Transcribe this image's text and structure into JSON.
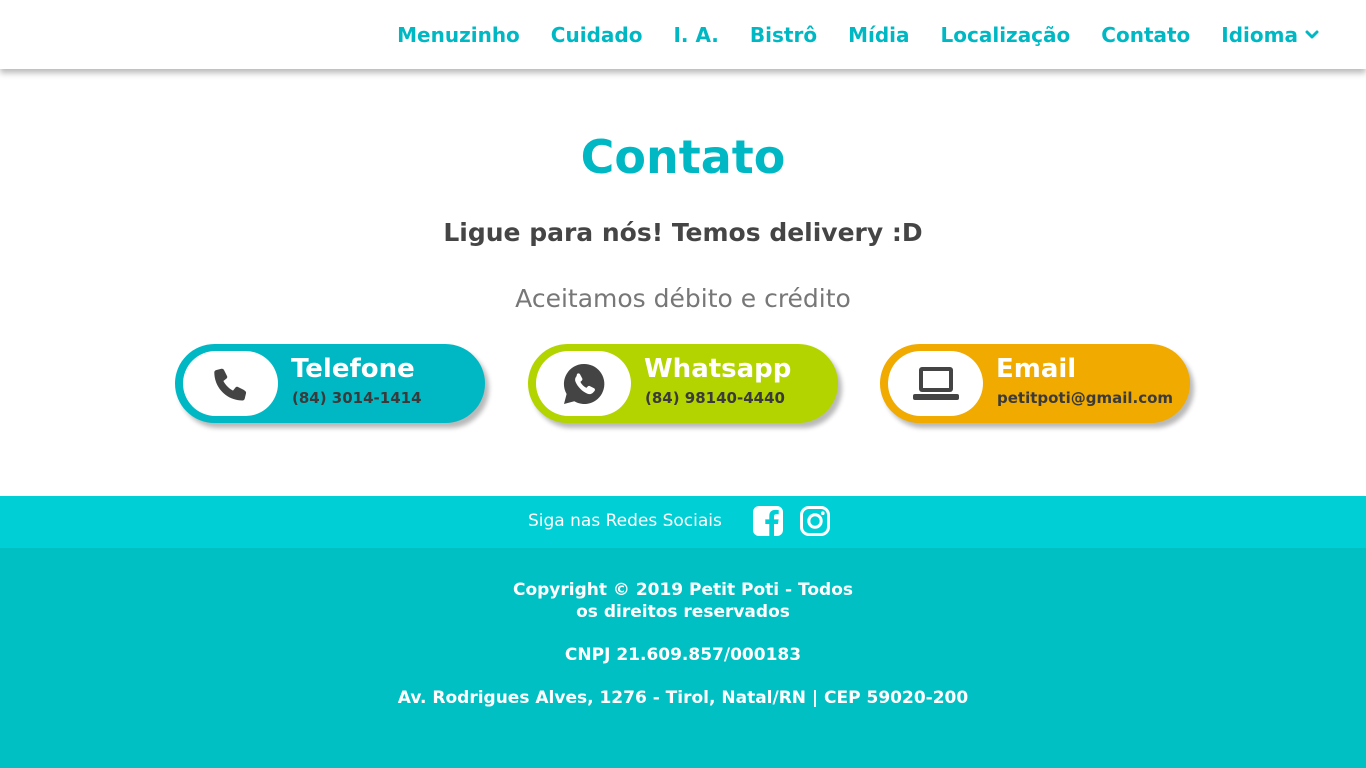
{
  "nav": {
    "items": [
      "Menuzinho",
      "Cuidado",
      "I. A.",
      "Bistrô",
      "Mídia",
      "Localização",
      "Contato"
    ],
    "language_label": "Idioma"
  },
  "main": {
    "title": "Contato",
    "subtitle": "Ligue para nós! Temos delivery :D",
    "payment_note": "Aceitamos débito e crédito"
  },
  "contacts": [
    {
      "title": "Telefone",
      "value": "(84) 3014-1414",
      "icon": "phone-icon",
      "color": "#00b8c4"
    },
    {
      "title": "Whatsapp",
      "value": "(84) 98140-4440",
      "icon": "whatsapp-icon",
      "color": "#b4d400"
    },
    {
      "title": "Email",
      "value": "petitpoti@gmail.com",
      "icon": "laptop-icon",
      "color": "#f0aa00"
    }
  ],
  "social": {
    "label": "Siga nas Redes Sociais",
    "icons": [
      "facebook-icon",
      "instagram-icon"
    ]
  },
  "footer": {
    "copyright_line1": "Copyright © 2019 Petit Poti - Todos",
    "copyright_line2": "os direitos reservados",
    "cnpj": "CNPJ 21.609.857/000183",
    "address": "Av. Rodrigues Alves, 1276 - Tirol, Natal/RN | CEP 59020-200"
  },
  "colors": {
    "accent": "#00b8c4",
    "social_bar": "#00d0d6",
    "footer": "#00c0c4"
  }
}
